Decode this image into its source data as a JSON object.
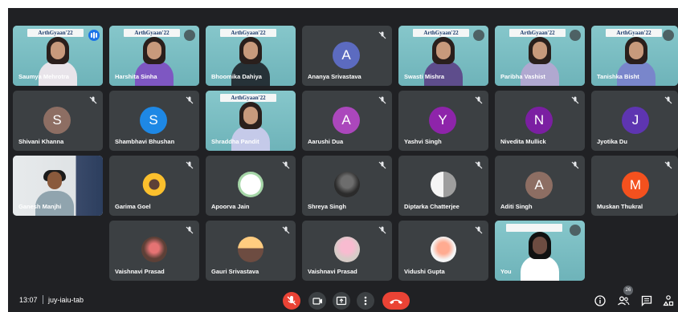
{
  "banner_text": "ArthGyaan'22",
  "participants": {
    "saumya": "Saumya Mehrotra",
    "harshita": "Harshita Sinha",
    "bhoomika": "Bhoomika Dahiya",
    "ananya": "Ananya Srivastava",
    "swasti": "Swasti Mishra",
    "paribha": "Paribha Vashist",
    "tanishka": "Tanishka Bisht",
    "shivani": "Shivani Khanna",
    "shambhavi": "Shambhavi Bhushan",
    "shraddha": "Shraddha Pandit",
    "aarushi": "Aarushi Dua",
    "yashvi": "Yashvi Singh",
    "nivedita": "Nivedita Mullick",
    "jyotika": "Jyotika Du",
    "ganesh": "Ganesh Manjhi",
    "garima": "Garima Goel",
    "apoorva": "Apoorva Jain",
    "shreya": "Shreya Singh",
    "diptarka": "Diptarka Chatterjee",
    "aditi": "Aditi Singh",
    "muskan": "Muskan Thukral",
    "vaishnavi1": "Vaishnavi Prasad",
    "gauri": "Gauri Srivastava",
    "vaishnavi2": "Vaishnavi Prasad",
    "vidushi": "Vidushi Gupta",
    "you": "You"
  },
  "avatar_letters": {
    "ananya": "A",
    "shivani": "S",
    "shambhavi": "S",
    "aarushi": "A",
    "yashvi": "Y",
    "nivedita": "N",
    "jyotika": "J",
    "aditi": "A",
    "muskan": "M"
  },
  "avatar_colors": {
    "ananya": "#5c6bc0",
    "shivani": "#8d6e63",
    "shambhavi": "#1e88e5",
    "aarushi": "#ab47bc",
    "yashvi": "#8e24aa",
    "nivedita": "#7b1fa2",
    "jyotika": "#5e35b1",
    "aditi": "#8d6e63",
    "muskan": "#f4511e"
  },
  "bottom_bar": {
    "time": "13:07",
    "meeting_code": "juy-iaiu-tab",
    "participant_count": "26"
  },
  "icons": {
    "mic": "mic-off-icon",
    "camera": "camera-icon",
    "present": "present-icon",
    "more": "more-options-icon",
    "end": "end-call-icon",
    "info": "info-icon",
    "people": "people-icon",
    "chat": "chat-icon",
    "activities": "activities-icon"
  }
}
